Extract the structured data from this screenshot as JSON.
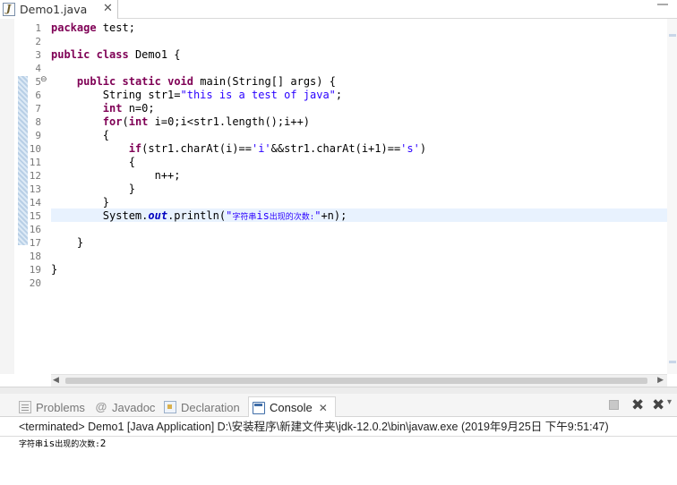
{
  "editor": {
    "tab": {
      "label": "Demo1.java",
      "icon": "java-file-icon",
      "close": "✕"
    },
    "current_line": 15,
    "line_numbers": [
      "1",
      "2",
      "3",
      "4",
      "5",
      "6",
      "7",
      "8",
      "9",
      "10",
      "11",
      "12",
      "13",
      "14",
      "15",
      "16",
      "17",
      "18",
      "19",
      "20"
    ],
    "lines": [
      [
        {
          "t": "package",
          "c": "kw"
        },
        {
          "t": " test;"
        }
      ],
      [],
      [
        {
          "t": "public",
          "c": "kw"
        },
        {
          "t": " "
        },
        {
          "t": "class",
          "c": "kw"
        },
        {
          "t": " Demo1 {"
        }
      ],
      [],
      [
        {
          "t": "    "
        },
        {
          "t": "public",
          "c": "kw"
        },
        {
          "t": " "
        },
        {
          "t": "static",
          "c": "kw"
        },
        {
          "t": " "
        },
        {
          "t": "void",
          "c": "kw"
        },
        {
          "t": " main(String[] args) {"
        }
      ],
      [
        {
          "t": "        String str1="
        },
        {
          "t": "\"this is a test of java\"",
          "c": "str"
        },
        {
          "t": ";"
        }
      ],
      [
        {
          "t": "        "
        },
        {
          "t": "int",
          "c": "kw"
        },
        {
          "t": " n=0;"
        }
      ],
      [
        {
          "t": "        "
        },
        {
          "t": "for",
          "c": "kw"
        },
        {
          "t": "("
        },
        {
          "t": "int",
          "c": "kw"
        },
        {
          "t": " i=0;i<str1.length();i++)"
        }
      ],
      [
        {
          "t": "        {"
        }
      ],
      [
        {
          "t": "            "
        },
        {
          "t": "if",
          "c": "kw"
        },
        {
          "t": "(str1.charAt(i)=="
        },
        {
          "t": "'i'",
          "c": "str"
        },
        {
          "t": "&&str1.charAt(i+1)=="
        },
        {
          "t": "'s'",
          "c": "str"
        },
        {
          "t": ")"
        }
      ],
      [
        {
          "t": "            {"
        }
      ],
      [
        {
          "t": "                n++;"
        }
      ],
      [
        {
          "t": "            }"
        }
      ],
      [
        {
          "t": "        }"
        }
      ],
      [
        {
          "t": "        System."
        },
        {
          "t": "out",
          "c": "fld"
        },
        {
          "t": ".println("
        },
        {
          "t": "\"",
          "c": "str"
        },
        {
          "t": "字符串",
          "c": "str cjk"
        },
        {
          "t": "is",
          "c": "str"
        },
        {
          "t": "出现的次数:",
          "c": "str cjk"
        },
        {
          "t": "\"",
          "c": "str"
        },
        {
          "t": "+n);"
        }
      ],
      [],
      [
        {
          "t": "    }"
        }
      ],
      [],
      [
        {
          "t": "}"
        }
      ],
      []
    ]
  },
  "views": {
    "tabs": [
      {
        "label": "Problems",
        "icon": "problems-icon"
      },
      {
        "label": "Javadoc",
        "icon": "javadoc-icon"
      },
      {
        "label": "Declaration",
        "icon": "declaration-icon"
      },
      {
        "label": "Console",
        "icon": "console-icon",
        "active": true,
        "close": "✕"
      }
    ],
    "javadoc_glyph": "@"
  },
  "console": {
    "header": "<terminated> Demo1 [Java Application] D:\\安装程序\\新建文件夹\\jdk-12.0.2\\bin\\javaw.exe (2019年9月25日 下午9:51:47)",
    "output_prefix": "字符串",
    "output_mid": "is",
    "output_suffix": "出现的次数:",
    "output_value": "2"
  },
  "colors": {
    "keyword": "#7f0055",
    "string": "#2a00ff",
    "static_field": "#0000c0",
    "current_line": "#e8f2fe",
    "line_number": "#787878"
  }
}
